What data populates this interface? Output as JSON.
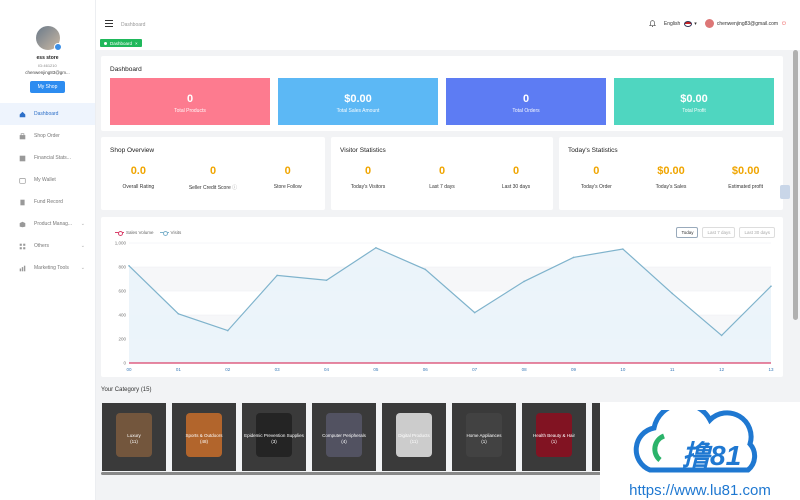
{
  "sidebar": {
    "store_name": "ess store",
    "store_id": "ID:461210",
    "email": "chenwenjing83@gm...",
    "my_shop": "My Shop",
    "items": [
      {
        "label": "Dashboard",
        "icon": "home-icon"
      },
      {
        "label": "Shop Order",
        "icon": "cart-icon"
      },
      {
        "label": "Financial Stats...",
        "icon": "finance-icon"
      },
      {
        "label": "My Wallet",
        "icon": "wallet-icon"
      },
      {
        "label": "Fund Record",
        "icon": "record-icon"
      },
      {
        "label": "Product Manag...",
        "icon": "product-icon"
      },
      {
        "label": "Others",
        "icon": "grid-icon"
      },
      {
        "label": "Marketing Tools",
        "icon": "chart-icon"
      }
    ]
  },
  "topbar": {
    "breadcrumb": "Dashboard",
    "tag": "Dashboard",
    "language": "English",
    "user_email": "chenwenjing83@gmail.com"
  },
  "dashboard": {
    "title": "Dashboard",
    "tiles": [
      {
        "value": "0",
        "label": "Total Products",
        "color": "#fd7b8f"
      },
      {
        "value": "$0.00",
        "label": "Total Sales Amount",
        "color": "#5cb8f5"
      },
      {
        "value": "0",
        "label": "Total Orders",
        "color": "#5d7cf3"
      },
      {
        "value": "$0.00",
        "label": "Total Profit",
        "color": "#4fd6c0"
      }
    ]
  },
  "shop_overview": {
    "title": "Shop Overview",
    "stats": [
      {
        "value": "0.0",
        "label": "Overall Rating"
      },
      {
        "value": "0",
        "label": "Seller Credit Score"
      },
      {
        "value": "0",
        "label": "Store Follow"
      }
    ]
  },
  "visitor_stats": {
    "title": "Visitor Statistics",
    "stats": [
      {
        "value": "0",
        "label": "Today's Visitors"
      },
      {
        "value": "0",
        "label": "Last 7 days"
      },
      {
        "value": "0",
        "label": "Last 30 days"
      }
    ]
  },
  "todays_stats": {
    "title": "Today's Statistics",
    "stats": [
      {
        "value": "0",
        "label": "Today's Order"
      },
      {
        "value": "$0.00",
        "label": "Today's Sales"
      },
      {
        "value": "$0.00",
        "label": "Estimated profit"
      }
    ]
  },
  "chart_controls": {
    "ranges": [
      "Today",
      "Last 7 days",
      "Last 30 days"
    ],
    "active": 0
  },
  "chart_data": {
    "type": "line",
    "categories": [
      "00",
      "01",
      "02",
      "03",
      "04",
      "05",
      "06",
      "07",
      "08",
      "09",
      "10",
      "11",
      "12",
      "13"
    ],
    "ylim": [
      0,
      1000
    ],
    "yticks": [
      0,
      200,
      400,
      600,
      800,
      "1,000"
    ],
    "series": [
      {
        "name": "Sales Volume",
        "color": "#d9416b",
        "values": [
          0,
          0,
          0,
          0,
          0,
          0,
          0,
          0,
          0,
          0,
          0,
          0,
          0,
          0
        ]
      },
      {
        "name": "Visits",
        "color": "#7fb3cc",
        "values": [
          810,
          410,
          270,
          730,
          690,
          960,
          780,
          420,
          680,
          880,
          950,
          580,
          230,
          640
        ]
      }
    ]
  },
  "categories": {
    "title": "Your Category",
    "count": "(15)",
    "items": [
      {
        "name": "Luxury",
        "count": "(11)",
        "tint": "#7a5a3e"
      },
      {
        "name": "Sports & Outdoors",
        "count": "(48)",
        "tint": "#c06a2b"
      },
      {
        "name": "Epidemic Prevention Supplies",
        "count": "(3)",
        "tint": "#222"
      },
      {
        "name": "Computer Peripherals",
        "count": "(4)",
        "tint": "#556"
      },
      {
        "name": "Digital Products",
        "count": "(11)",
        "tint": "#ddd"
      },
      {
        "name": "Home Appliances",
        "count": "(1)",
        "tint": "#444"
      },
      {
        "name": "Health Beauty & Hair",
        "count": "(1)",
        "tint": "#8a1020"
      },
      {
        "name": "",
        "count": "",
        "tint": "#555"
      },
      {
        "name": "",
        "count": "",
        "tint": "#666"
      },
      {
        "name": "",
        "count": "",
        "tint": "#777"
      }
    ]
  },
  "watermark": {
    "text": "撸81",
    "url": "https://www.lu81.com"
  }
}
